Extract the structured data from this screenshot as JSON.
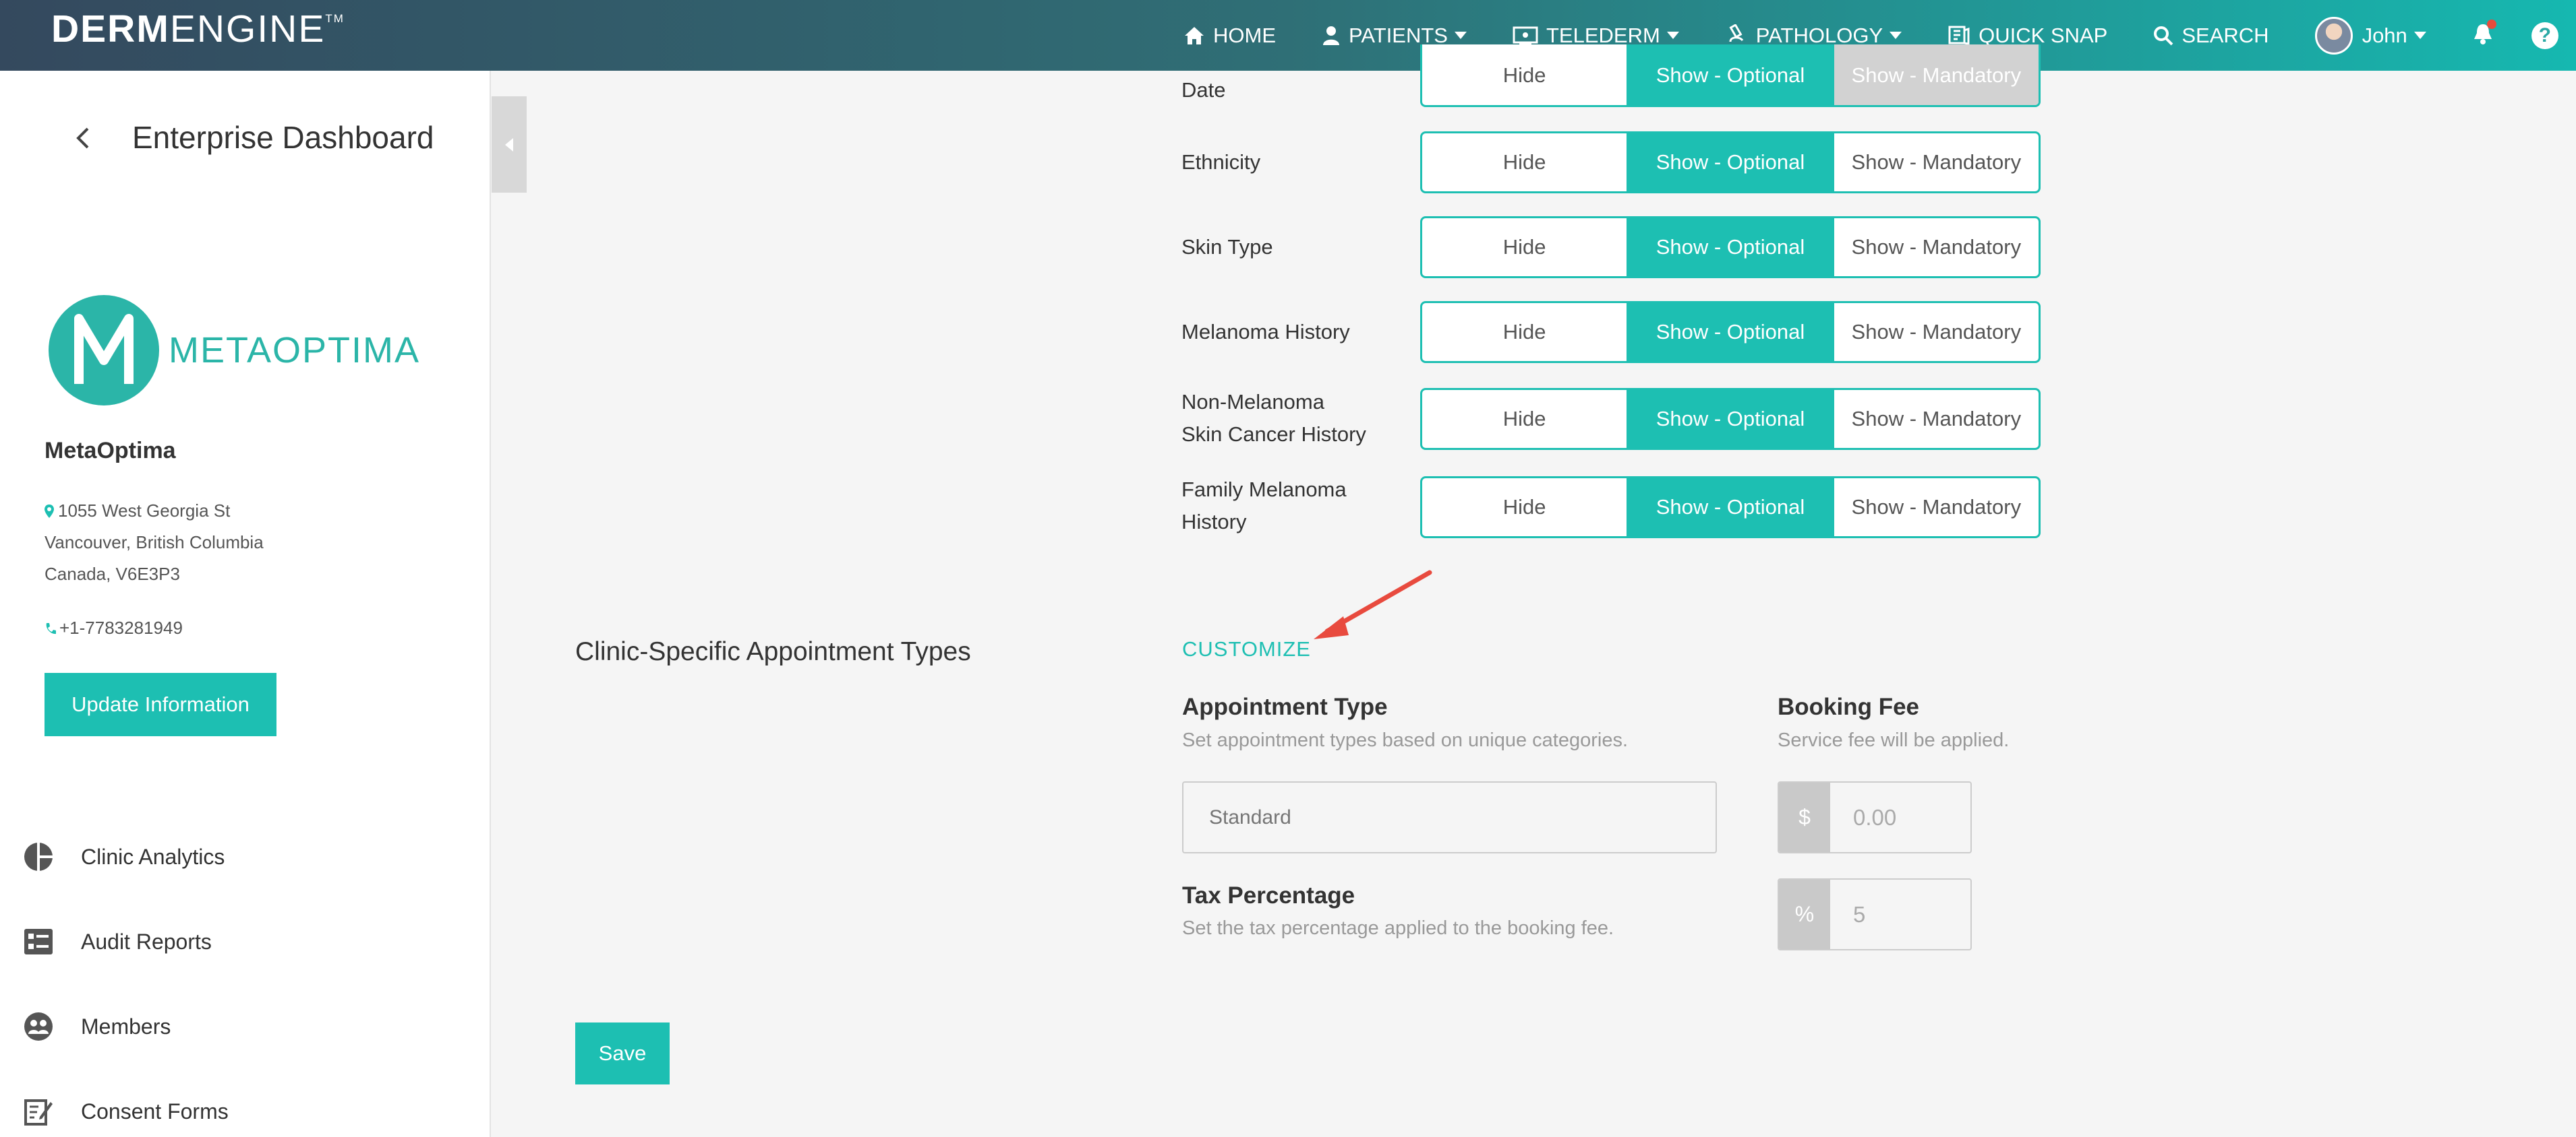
{
  "brand": {
    "logo_bold": "DERM",
    "logo_light": "ENGINE",
    "logo_tm": "TM"
  },
  "nav": {
    "home": "HOME",
    "patients": "PATIENTS",
    "telederm": "TELEDERM",
    "pathology": "PATHOLOGY",
    "quick_snap": "QUICK SNAP",
    "search": "SEARCH",
    "user": "John",
    "help": "?"
  },
  "sidebar": {
    "title": "Enterprise Dashboard",
    "org_logo_text": "METAOPTIMA",
    "org_name": "MetaOptima",
    "address": [
      "1055 West Georgia St",
      "Vancouver, British Columbia",
      "Canada, V6E3P3"
    ],
    "phone": "+1-7783281949",
    "update_button": "Update Information",
    "menu": [
      {
        "label": "Clinic Analytics",
        "icon": "pie-chart-icon"
      },
      {
        "label": "Audit Reports",
        "icon": "report-list-icon"
      },
      {
        "label": "Members",
        "icon": "members-icon"
      },
      {
        "label": "Consent Forms",
        "icon": "edit-form-icon"
      }
    ]
  },
  "fields": {
    "options": {
      "hide": "Hide",
      "optional": "Show - Optional",
      "mandatory": "Show - Mandatory"
    },
    "rows": [
      {
        "label": "Date",
        "active": "optional"
      },
      {
        "label": "Ethnicity",
        "active": "optional"
      },
      {
        "label": "Skin Type",
        "active": "optional"
      },
      {
        "label": "Melanoma History",
        "active": "optional"
      },
      {
        "label_line1": "Non-Melanoma",
        "label_line2": "Skin Cancer History",
        "active": "optional"
      },
      {
        "label_line1": "Family Melanoma",
        "label_line2": "History",
        "active": "optional"
      }
    ]
  },
  "appointments": {
    "section_title": "Clinic-Specific Appointment Types",
    "customize": "CUSTOMIZE",
    "type_title": "Appointment Type",
    "type_sub": "Set appointment types based on unique categories.",
    "type_placeholder": "Standard",
    "fee_title": "Booking Fee",
    "fee_sub": "Service fee will be applied.",
    "fee_symbol": "$",
    "fee_value": "0.00",
    "tax_title": "Tax Percentage",
    "tax_sub": "Set the tax percentage applied to the booking fee.",
    "tax_symbol": "%",
    "tax_value": "5"
  },
  "save_button": "Save",
  "colors": {
    "accent": "#1dbfb2",
    "arrow": "#e84a3e"
  }
}
